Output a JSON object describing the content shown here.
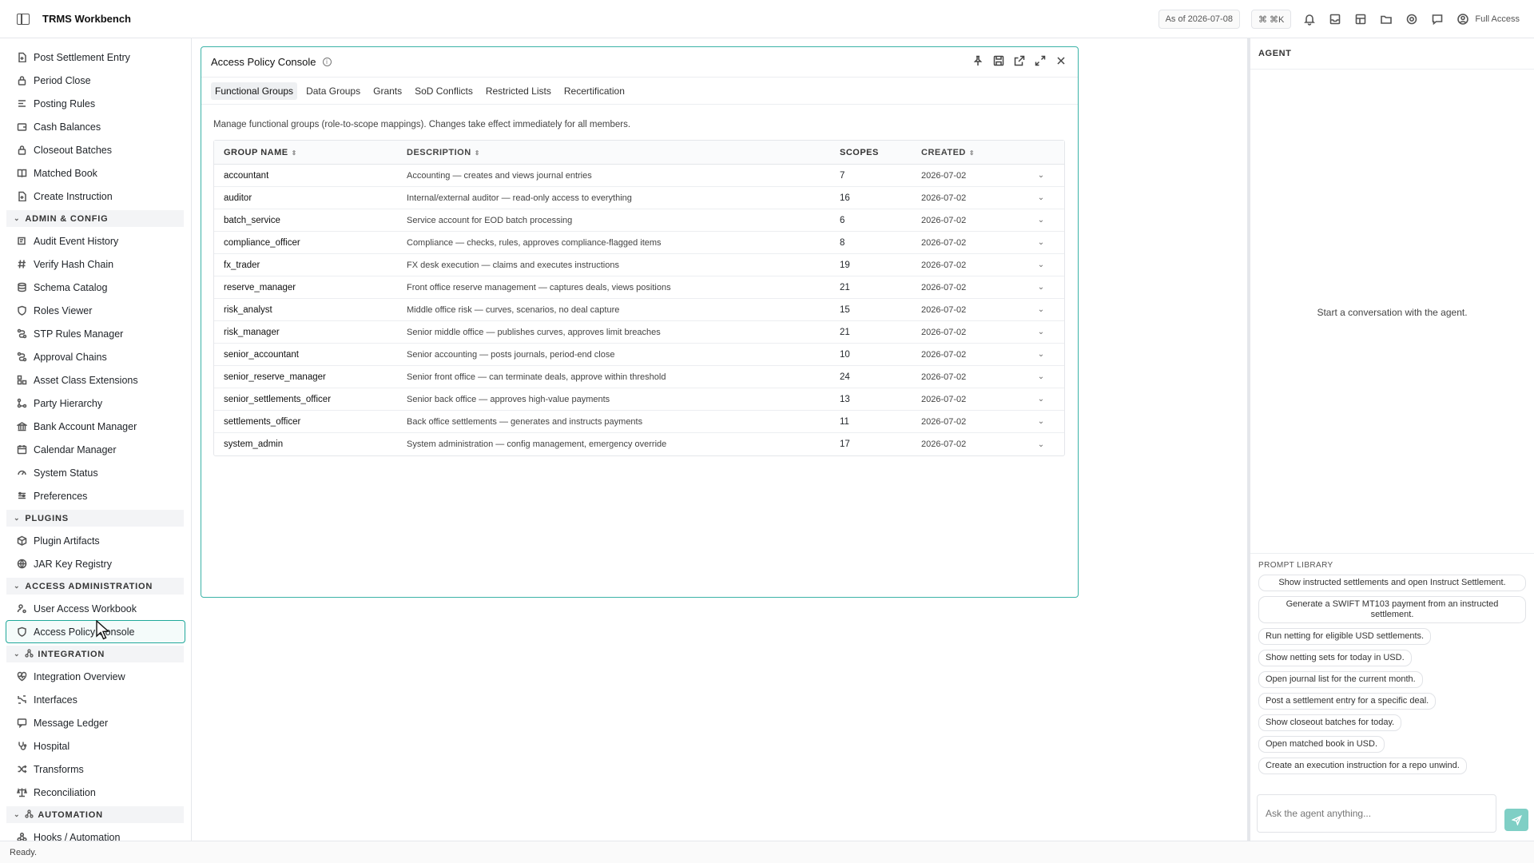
{
  "app": {
    "title": "TRMS Workbench"
  },
  "topbar": {
    "as_of": "As of 2026-07-08",
    "shortcut": "⌘ ⌘K",
    "access": "Full Access"
  },
  "sidebar": {
    "groups": [
      {
        "items": [
          {
            "label": "Post Settlement Entry",
            "icon": "file-plus-icon"
          },
          {
            "label": "Period Close",
            "icon": "lock-icon"
          },
          {
            "label": "Posting Rules",
            "icon": "list-rules-icon"
          },
          {
            "label": "Cash Balances",
            "icon": "wallet-icon"
          },
          {
            "label": "Closeout Batches",
            "icon": "lock-icon"
          },
          {
            "label": "Matched Book",
            "icon": "book-icon"
          },
          {
            "label": "Create Instruction",
            "icon": "file-plus-icon"
          }
        ]
      },
      {
        "section": "ADMIN & CONFIG",
        "items": [
          {
            "label": "Audit Event History",
            "icon": "history-icon"
          },
          {
            "label": "Verify Hash Chain",
            "icon": "hash-icon"
          },
          {
            "label": "Schema Catalog",
            "icon": "database-icon"
          },
          {
            "label": "Roles Viewer",
            "icon": "shield-icon"
          },
          {
            "label": "STP Rules Manager",
            "icon": "workflow-icon"
          },
          {
            "label": "Approval Chains",
            "icon": "workflow-icon"
          },
          {
            "label": "Asset Class Extensions",
            "icon": "blocks-icon"
          },
          {
            "label": "Party Hierarchy",
            "icon": "hierarchy-icon"
          },
          {
            "label": "Bank Account Manager",
            "icon": "bank-icon"
          },
          {
            "label": "Calendar Manager",
            "icon": "calendar-icon"
          },
          {
            "label": "System Status",
            "icon": "gauge-icon"
          },
          {
            "label": "Preferences",
            "icon": "sliders-icon"
          }
        ]
      },
      {
        "section": "PLUGINS",
        "items": [
          {
            "label": "Plugin Artifacts",
            "icon": "package-icon"
          },
          {
            "label": "JAR Key Registry",
            "icon": "globe-icon"
          }
        ]
      },
      {
        "section": "ACCESS ADMINISTRATION",
        "items": [
          {
            "label": "User Access Workbook",
            "icon": "user-cog-icon"
          },
          {
            "label": "Access Policy Console",
            "icon": "shield-icon",
            "active": true
          }
        ]
      },
      {
        "section": "INTEGRATION",
        "items": [
          {
            "label": "Integration Overview",
            "icon": "heart-pulse-icon"
          },
          {
            "label": "Interfaces",
            "icon": "interface-icon"
          },
          {
            "label": "Message Ledger",
            "icon": "message-icon"
          },
          {
            "label": "Hospital",
            "icon": "stethoscope-icon"
          },
          {
            "label": "Transforms",
            "icon": "shuffle-icon"
          },
          {
            "label": "Reconciliation",
            "icon": "scale-icon"
          }
        ]
      },
      {
        "section": "AUTOMATION",
        "items": [
          {
            "label": "Hooks / Automation",
            "icon": "webhook-icon"
          }
        ]
      }
    ]
  },
  "panel": {
    "title": "Access Policy Console",
    "tabs": [
      "Functional Groups",
      "Data Groups",
      "Grants",
      "SoD Conflicts",
      "Restricted Lists",
      "Recertification"
    ],
    "active_tab": 0,
    "description": "Manage functional groups (role-to-scope mappings). Changes take effect immediately for all members.",
    "columns": [
      "GROUP NAME",
      "DESCRIPTION",
      "SCOPES",
      "CREATED"
    ],
    "rows": [
      [
        "accountant",
        "Accounting — creates and views journal entries",
        "7",
        "2026-07-02"
      ],
      [
        "auditor",
        "Internal/external auditor — read-only access to everything",
        "16",
        "2026-07-02"
      ],
      [
        "batch_service",
        "Service account for EOD batch processing",
        "6",
        "2026-07-02"
      ],
      [
        "compliance_officer",
        "Compliance — checks, rules, approves compliance-flagged items",
        "8",
        "2026-07-02"
      ],
      [
        "fx_trader",
        "FX desk execution — claims and executes instructions",
        "19",
        "2026-07-02"
      ],
      [
        "reserve_manager",
        "Front office reserve management — captures deals, views positions",
        "21",
        "2026-07-02"
      ],
      [
        "risk_analyst",
        "Middle office risk — curves, scenarios, no deal capture",
        "15",
        "2026-07-02"
      ],
      [
        "risk_manager",
        "Senior middle office — publishes curves, approves limit breaches",
        "21",
        "2026-07-02"
      ],
      [
        "senior_accountant",
        "Senior accounting — posts journals, period-end close",
        "10",
        "2026-07-02"
      ],
      [
        "senior_reserve_manager",
        "Senior front office — can terminate deals, approve within threshold",
        "24",
        "2026-07-02"
      ],
      [
        "senior_settlements_officer",
        "Senior back office — approves high-value payments",
        "13",
        "2026-07-02"
      ],
      [
        "settlements_officer",
        "Back office settlements — generates and instructs payments",
        "11",
        "2026-07-02"
      ],
      [
        "system_admin",
        "System administration — config management, emergency override",
        "17",
        "2026-07-02"
      ]
    ]
  },
  "agent": {
    "heading": "AGENT",
    "empty": "Start a conversation with the agent.",
    "library_label": "PROMPT LIBRARY",
    "prompts": [
      "Show instructed settlements and open Instruct Settlement.",
      "Generate a SWIFT MT103 payment from an instructed settlement.",
      "Run netting for eligible USD settlements.",
      "Show netting sets for today in USD.",
      "Open journal list for the current month.",
      "Post a settlement entry for a specific deal.",
      "Show closeout batches for today.",
      "Open matched book in USD.",
      "Create an execution instruction for a repo unwind."
    ],
    "input_placeholder": "Ask the agent anything..."
  },
  "status": {
    "text": "Ready."
  }
}
